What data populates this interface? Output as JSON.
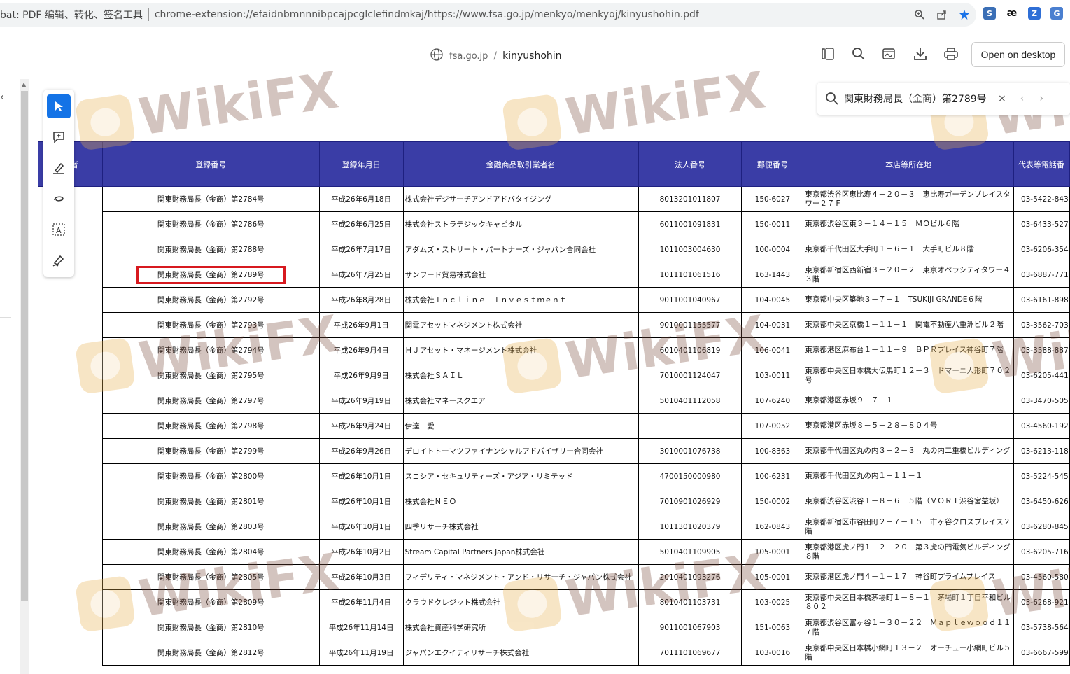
{
  "addressbar": {
    "prefix": "bat: PDF 编辑、转化、签名工具",
    "url": "chrome-extension://efaidnbmnnnibpcajpcglclefindmkaj/https://www.fsa.go.jp/menkyo/menkyoj/kinyushohin.pdf"
  },
  "viewer": {
    "domain": "fsa.go.jp",
    "separator": "/",
    "filename": "kinyushohin",
    "open_desktop": "Open on desktop"
  },
  "find": {
    "query": "関東財務局長（金商）第2789号",
    "close": "×",
    "prev": "‹",
    "next": "›"
  },
  "watermark": "WikiFX",
  "table": {
    "edge_header": "者",
    "headers": [
      "登録番号",
      "登録年月日",
      "金融商品取引業者名",
      "法人番号",
      "郵便番号",
      "本店等所在地",
      "代表等電話番"
    ],
    "rows": [
      [
        "関東財務局長（金商）第2784号",
        "平成26年6月18日",
        "株式会社デジサーチアンドアドバタイジング",
        "8013201011807",
        "150-6027",
        "東京都渋谷区恵比寿４－２０－３　恵比寿ガーデンプレイスタワー２７Ｆ",
        "03-5422-843"
      ],
      [
        "関東財務局長（金商）第2786号",
        "平成26年6月25日",
        "株式会社ストラテジックキャピタル",
        "6011001091831",
        "150-0011",
        "東京都渋谷区東３－１４－１５　ＭＯビル６階",
        "03-6433-527"
      ],
      [
        "関東財務局長（金商）第2788号",
        "平成26年7月17日",
        "アダムズ・ストリート・パートナーズ・ジャパン合同会社",
        "1011003004630",
        "100-0004",
        "東京都千代田区大手町１－６－１　大手町ビル８階",
        "03-6206-354"
      ],
      [
        "関東財務局長（金商）第2789号",
        "平成26年7月25日",
        "サンワード貿易株式会社",
        "1011101061516",
        "163-1443",
        "東京都新宿区西新宿３－２０－２　東京オペラシティタワー４３階",
        "03-6887-771"
      ],
      [
        "関東財務局長（金商）第2792号",
        "平成26年8月28日",
        "株式会社Ｉｎｃｌｉｎｅ　Ｉｎｖｅｓｔｍｅｎｔ",
        "9011001040967",
        "104-0045",
        "東京都中央区築地３－７－１　TSUKIJI GRANDE６階",
        "03-6161-898"
      ],
      [
        "関東財務局長（金商）第2793号",
        "平成26年9月1日",
        "関電アセットマネジメント株式会社",
        "9010001155577",
        "104-0031",
        "東京都中央区京橋１－１１－１　関電不動産八重洲ビル２階",
        "03-3562-703"
      ],
      [
        "関東財務局長（金商）第2794号",
        "平成26年9月4日",
        "ＨＪアセット・マネージメント株式会社",
        "6010401106819",
        "106-0041",
        "東京都港区麻布台１－１１－９　ＢＰＲプレイス神谷町７階",
        "03-3588-887"
      ],
      [
        "関東財務局長（金商）第2795号",
        "平成26年9月9日",
        "株式会社ＳＡＩＬ",
        "7010001124047",
        "103-0011",
        "東京都中央区日本橋大伝馬町１２－３　ドマーニ人形町７０２号",
        "03-6205-441"
      ],
      [
        "関東財務局長（金商）第2797号",
        "平成26年9月19日",
        "株式会社マネースクエア",
        "5010401112058",
        "107-6240",
        "東京都港区赤坂９－７－１",
        "03-3470-505"
      ],
      [
        "関東財務局長（金商）第2798号",
        "平成26年9月24日",
        "伊達　愛",
        "－",
        "107-0052",
        "東京都港区赤坂８－５－２８－８０４号",
        "03-4560-192"
      ],
      [
        "関東財務局長（金商）第2799号",
        "平成26年9月26日",
        "デロイトトーマツファイナンシャルアドバイザリー合同会社",
        "3010001076738",
        "100-8363",
        "東京都千代田区丸の内３－２－３　丸の内二重橋ビルディング",
        "03-6213-118"
      ],
      [
        "関東財務局長（金商）第2800号",
        "平成26年10月1日",
        "スコシア・セキュリティーズ・アジア・リミテッド",
        "4700150000980",
        "100-6231",
        "東京都千代田区丸の内１－１１－１",
        "03-5224-545"
      ],
      [
        "関東財務局長（金商）第2801号",
        "平成26年10月1日",
        "株式会社ＮＥＯ",
        "7010901026929",
        "150-0002",
        "東京都渋谷区渋谷１－８－６　５階（ＶＯＲＴ渋谷宮益坂）",
        "03-6450-626"
      ],
      [
        "関東財務局長（金商）第2803号",
        "平成26年10月1日",
        "四季リサーチ株式会社",
        "1011301020379",
        "162-0843",
        "東京都新宿区市谷田町２－７－１５　市ヶ谷クロスプレイス２階",
        "03-6280-845"
      ],
      [
        "関東財務局長（金商）第2804号",
        "平成26年10月2日",
        "Stream Capital Partners Japan株式会社",
        "5010401109905",
        "105-0001",
        "東京都港区虎ノ門１－２－２０　第３虎の門電気ビルディング８階",
        "03-6205-716"
      ],
      [
        "関東財務局長（金商）第2805号",
        "平成26年10月3日",
        "フィデリティ・マネジメント・アンド・リサーチ・ジャパン株式会社",
        "2010401093276",
        "105-0001",
        "東京都港区虎ノ門４－１－１７　神谷町プライムプレイス",
        "03-4560-580"
      ],
      [
        "関東財務局長（金商）第2809号",
        "平成26年11月4日",
        "クラウドクレジット株式会社",
        "8010401103731",
        "103-0025",
        "東京都中央区日本橋茅場町１－８－１　茅場町１丁目平和ビル８０２",
        "03-6268-921"
      ],
      [
        "関東財務局長（金商）第2810号",
        "平成26年11月14日",
        "株式会社資産科学研究所",
        "9011001067903",
        "151-0063",
        "東京都渋谷区富ヶ谷１－３０－２２　Ｍａｐｌｅｗｏｏｄ１１　７階",
        "03-5738-564"
      ],
      [
        "関東財務局長（金商）第2812号",
        "平成26年11月19日",
        "ジャパンエクイティリサーチ株式会社",
        "7011101069677",
        "103-0016",
        "東京都中央区日本橋小網町１３－２　オーチュー小網町ビル５階",
        "03-6667-599"
      ]
    ],
    "highlight_row": 3
  }
}
